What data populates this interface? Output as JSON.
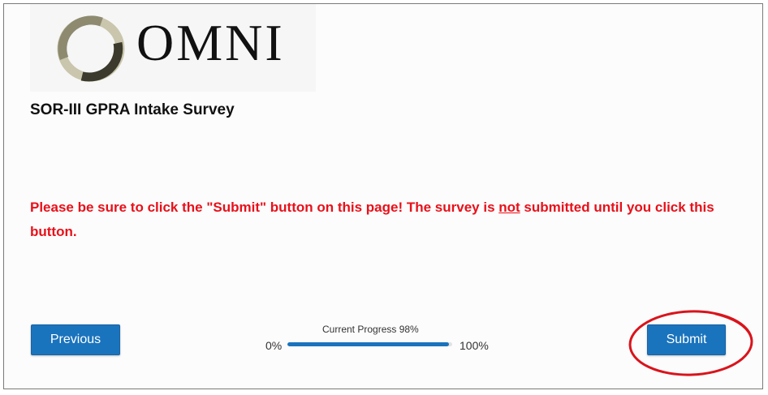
{
  "brand": {
    "name": "OMNI",
    "ring_colors": [
      "#3c3a2c",
      "#8d8a70",
      "#c9c6ad"
    ]
  },
  "survey": {
    "title": "SOR-III GPRA Intake Survey"
  },
  "warning": {
    "text_before": "Please be sure to click the \"Submit\" button on this page! The survey is ",
    "emphasis": "not",
    "text_after": " submitted until you click this button.",
    "color": "#e8101a"
  },
  "navigation": {
    "previous_label": "Previous",
    "submit_label": "Submit",
    "button_color": "#1a73bd"
  },
  "progress": {
    "caption": "Current Progress 98%",
    "value": 98,
    "min_label": "0%",
    "max_label": "100%"
  },
  "annotation": {
    "highlight_color": "#d9141c",
    "icon": "circle-highlight-icon"
  }
}
